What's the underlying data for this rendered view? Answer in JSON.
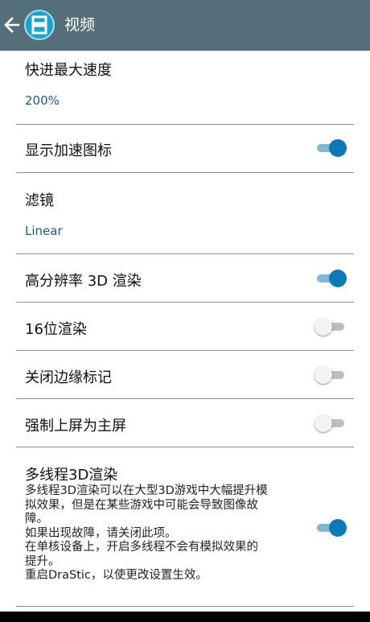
{
  "header": {
    "title": "视频",
    "back_icon": "arrow-left-icon",
    "app_icon": "drastic-app-icon",
    "background_color": "#546e7a"
  },
  "settings": [
    {
      "label": "快进最大速度",
      "value": "200%"
    },
    {
      "label": "显示加速图标",
      "enabled": true
    },
    {
      "label": "滤镜",
      "value": "Linear"
    },
    {
      "label": "高分辨率 3D 渲染",
      "enabled": true
    },
    {
      "label": "16位渲染",
      "enabled": false
    },
    {
      "label": "关闭边缘标记",
      "enabled": false
    },
    {
      "label": "强制上屏为主屏",
      "enabled": false
    },
    {
      "label": "多线程3D渲染",
      "enabled": true,
      "description_lines": [
        "多线程3D渲染可以在大型3D游戏中大幅提升模",
        "拟效果，但是在某些游戏中可能会导致图像故",
        "障。",
        "如果出现故障，请关闭此项。",
        "在单核设备上，开启多线程不会有模拟效果的",
        "提升。",
        "重启DraStic，以使更改设置生效。"
      ]
    }
  ],
  "colors": {
    "accent": "#0b7ab5",
    "value_text": "#1f5b77",
    "divider": "#8c8c8c"
  }
}
